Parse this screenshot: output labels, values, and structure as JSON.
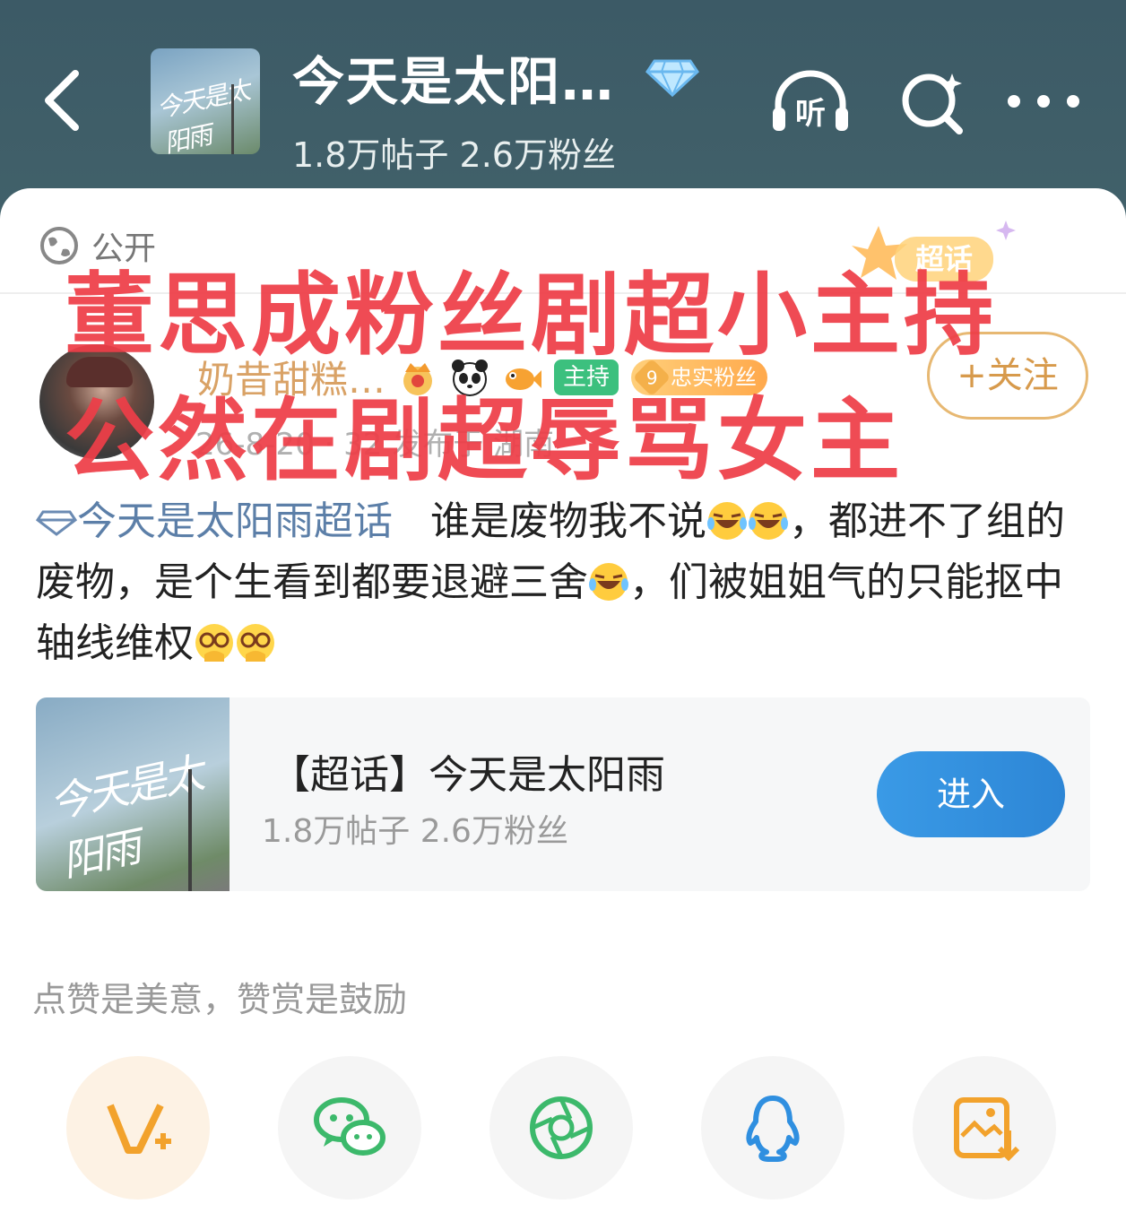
{
  "header": {
    "back_icon": "chevron-left-icon",
    "topic_title": "今天是太阳…",
    "topic_stats": "1.8万帖子 2.6万粉丝",
    "listen_label": "听",
    "search_icon": "search-icon",
    "more_icon": "more-icon"
  },
  "post": {
    "visibility": "公开",
    "super_badge_text": "超话",
    "author": {
      "name": "奶昔甜糕…",
      "host_badge": "主持",
      "fan_badge_level": "9",
      "fan_badge_text": "忠实粉丝"
    },
    "meta": "26-8-20 · 32 发布于 湖南",
    "follow_label": "+关注",
    "content": {
      "topic_link": "今天是太阳雨超话",
      "text_1": "谁是废物我不说",
      "text_2": "，都进不了组的废物，是个生看到都要退避三舍",
      "text_3": "，们被姐姐气的只能抠中轴线维权"
    }
  },
  "topic_card": {
    "title": "【超话】今天是太阳雨",
    "stats": "1.8万帖子 2.6万粉丝",
    "enter_label": "进入",
    "cover_art_text": "今天是太阳雨"
  },
  "like_hint": "点赞是美意，赞赏是鼓励",
  "share_buttons": [
    {
      "icon": "v-plus-icon"
    },
    {
      "icon": "wechat-icon"
    },
    {
      "icon": "moments-icon"
    },
    {
      "icon": "qq-icon"
    },
    {
      "icon": "save-image-icon"
    }
  ],
  "overlay_caption": {
    "line_1": "董思成粉丝剧超小主持",
    "line_2": "公然在剧超辱骂女主"
  },
  "colors": {
    "overlay_red": "#ee3e48",
    "enter_blue": "#2d86d6",
    "username_gold": "#d9a266",
    "host_green": "#3cc07e"
  }
}
